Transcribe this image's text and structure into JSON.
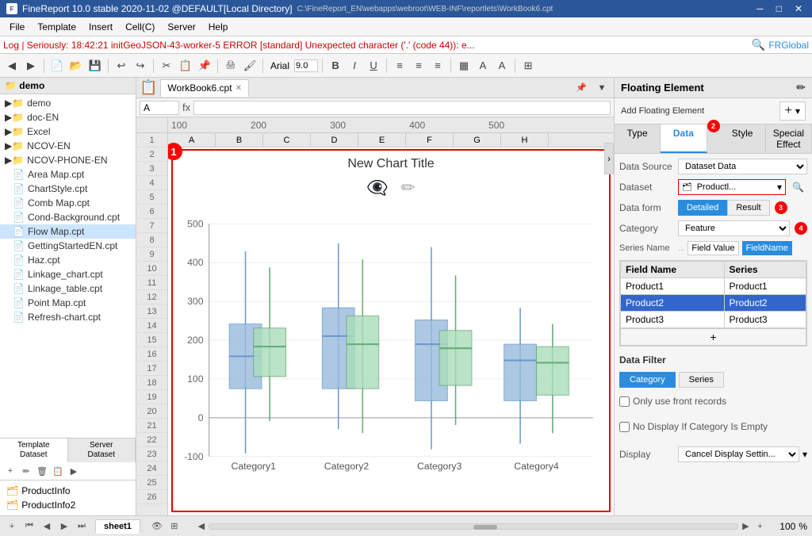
{
  "titlebar": {
    "app_name": "FineReport 10.0 stable 2020-11-02 @DEFAULT[Local Directory]",
    "file_path": "C:\\FineReport_EN\\webapps\\webroot\\WEB-INF\\reportlets\\WorkBook6.cpt",
    "min": "─",
    "max": "□",
    "close": "✕"
  },
  "menubar": {
    "items": [
      "File",
      "Template",
      "Insert",
      "Cell(C)",
      "Server",
      "Help"
    ]
  },
  "logbar": {
    "text": "Log | Seriously: 18:42:21 initGeoJSON-43-worker-5 ERROR [standard] Unexpected character ('.' (code 44)): e...",
    "search_icon": "🔍",
    "global": "FRGlobal"
  },
  "formula_bar": {
    "cell_ref": "A",
    "formula": ""
  },
  "tab": {
    "name": "WorkBook6.cpt"
  },
  "sidebar": {
    "title": "demo",
    "items": [
      {
        "label": "demo",
        "type": "folder",
        "icon": "📁"
      },
      {
        "label": "doc-EN",
        "type": "folder",
        "icon": "📁"
      },
      {
        "label": "Excel",
        "type": "folder",
        "icon": "📁"
      },
      {
        "label": "NCOV-EN",
        "type": "folder",
        "icon": "📁"
      },
      {
        "label": "NCOV-PHONE-EN",
        "type": "folder",
        "icon": "📁"
      },
      {
        "label": "Area Map.cpt",
        "type": "file",
        "icon": "📄"
      },
      {
        "label": "ChartStyle.cpt",
        "type": "file",
        "icon": "📄"
      },
      {
        "label": "Comb Map.cpt",
        "type": "file",
        "icon": "📄"
      },
      {
        "label": "Cond-Background.cpt",
        "type": "file",
        "icon": "📄"
      },
      {
        "label": "Flow Map.cpt",
        "type": "file",
        "icon": "📄"
      },
      {
        "label": "GettingStartedEN.cpt",
        "type": "file",
        "icon": "📄"
      },
      {
        "label": "Haz.cpt",
        "type": "file",
        "icon": "📄"
      },
      {
        "label": "Linkage_chart.cpt",
        "type": "file",
        "icon": "📄"
      },
      {
        "label": "Linkage_table.cpt",
        "type": "file",
        "icon": "📄"
      },
      {
        "label": "Point Map.cpt",
        "type": "file",
        "icon": "📄"
      },
      {
        "label": "Refresh-chart.cpt",
        "type": "file",
        "icon": "📄"
      }
    ],
    "bottom_tabs": [
      "Template\nDataset",
      "Server\nDataset"
    ],
    "datasets": [
      {
        "label": "ProductInfo",
        "icon": "🗂"
      },
      {
        "label": "ProductInfo2",
        "icon": "🗂"
      }
    ]
  },
  "chart": {
    "title": "New Chart Title",
    "categories": [
      "Category1",
      "Category2",
      "Category3",
      "Category4"
    ],
    "y_labels": [
      "500",
      "400",
      "300",
      "200",
      "100",
      "0",
      "-100"
    ]
  },
  "right_panel": {
    "title": "Floating Element",
    "add_btn": "Add Floating Element",
    "plus_icon": "+",
    "settings_icon": "✏",
    "tabs": [
      {
        "label": "Type",
        "id": "type"
      },
      {
        "label": "Data",
        "id": "data",
        "active": true
      },
      {
        "label": "Style",
        "id": "style"
      },
      {
        "label": "Special Effect",
        "id": "special_effect"
      }
    ],
    "data_source_label": "Data Source",
    "data_source_value": "Dataset Data",
    "dataset_label": "Dataset",
    "dataset_value": "Productl...",
    "data_form_label": "Data form",
    "data_form_options": [
      "Detailed",
      "Result"
    ],
    "data_form_active": "Detailed",
    "category_label": "Category",
    "category_value": "Feature",
    "series_name_label": "Series Name",
    "series_name_field": "Field Value",
    "series_name_highlight": "FieldName",
    "table_headers": [
      "Field Name",
      "Series"
    ],
    "table_rows": [
      {
        "field": "Product1",
        "series": "Product1",
        "selected": false
      },
      {
        "field": "Product2",
        "series": "Product2",
        "selected": true
      },
      {
        "field": "Product3",
        "series": "Product3",
        "selected": false
      }
    ],
    "add_row_btn": "+",
    "data_filter_title": "Data Filter",
    "filter_tabs": [
      "Category",
      "Series"
    ],
    "filter_active": "Category",
    "only_front_label": "Only use front records",
    "no_display_label": "No Display If Category Is Empty",
    "display_label": "Display",
    "display_value": "Cancel Display Settin...",
    "badges": {
      "b1": "1",
      "b2": "2",
      "b3": "3",
      "b4": "4"
    }
  },
  "bottom": {
    "sheet_tab": "sheet1",
    "zoom": "100",
    "zoom_unit": "%"
  },
  "columns": [
    "A",
    "B",
    "C",
    "D",
    "E",
    "F",
    "G",
    "H"
  ],
  "rows": [
    "1",
    "2",
    "3",
    "4",
    "5",
    "6",
    "7",
    "8",
    "9",
    "10",
    "11",
    "12",
    "13",
    "14",
    "15",
    "16",
    "17",
    "18",
    "19",
    "20",
    "21",
    "22",
    "23",
    "24",
    "25",
    "26"
  ]
}
